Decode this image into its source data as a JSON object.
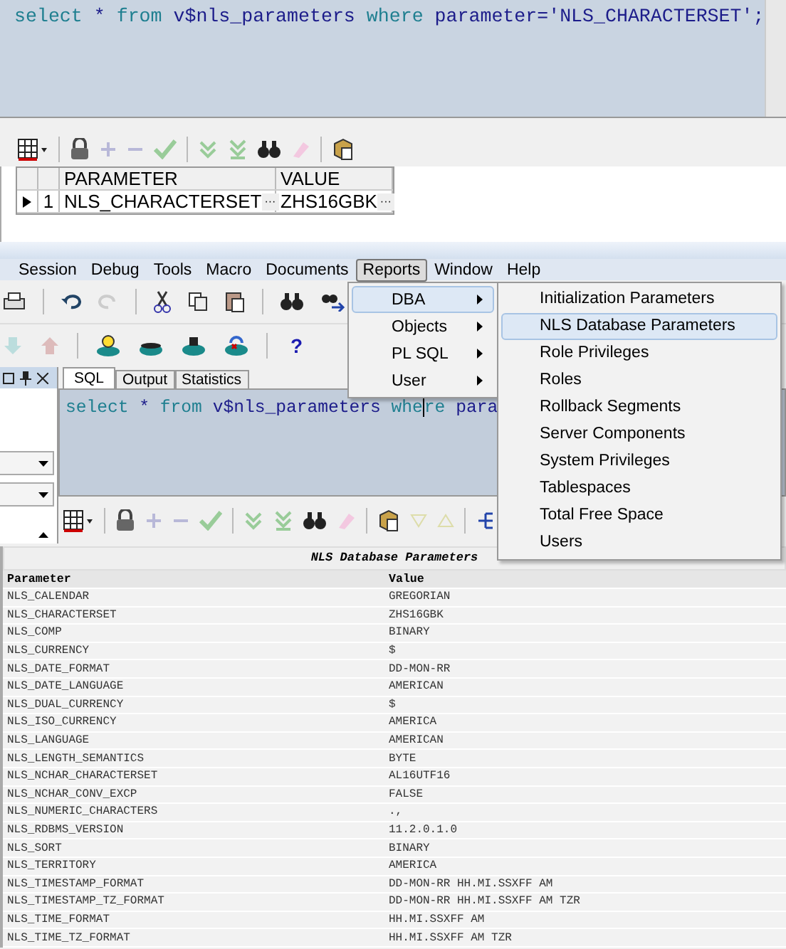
{
  "top_editor": {
    "tokens": [
      {
        "text": "select",
        "kind": "keyword"
      },
      {
        "text": " * ",
        "kind": "plain"
      },
      {
        "text": "from",
        "kind": "keyword"
      },
      {
        "text": " v$nls_parameters ",
        "kind": "plain"
      },
      {
        "text": "where",
        "kind": "keyword"
      },
      {
        "text": " parameter=",
        "kind": "plain"
      },
      {
        "text": "'NLS_CHARACTERSET'",
        "kind": "string"
      },
      {
        "text": ";",
        "kind": "plain"
      }
    ]
  },
  "result_grid": {
    "columns": [
      "PARAMETER",
      "VALUE"
    ],
    "rows": [
      {
        "number": "1",
        "selected": true,
        "cells": [
          {
            "text": "NLS_CHARACTERSET",
            "more": "···"
          },
          {
            "text": "ZHS16GBK",
            "more": "···"
          }
        ]
      }
    ]
  },
  "menu_bar": [
    {
      "label": "Session",
      "selected": false
    },
    {
      "label": "Debug",
      "selected": false
    },
    {
      "label": "Tools",
      "selected": false
    },
    {
      "label": "Macro",
      "selected": false
    },
    {
      "label": "Documents",
      "selected": false
    },
    {
      "label": "Reports",
      "selected": true
    },
    {
      "label": "Window",
      "selected": false
    },
    {
      "label": "Help",
      "selected": false
    }
  ],
  "reports_menu": [
    {
      "label": "DBA",
      "selected": true
    },
    {
      "label": "Objects",
      "selected": false
    },
    {
      "label": "PL SQL",
      "selected": false
    },
    {
      "label": "User",
      "selected": false
    }
  ],
  "dba_submenu": [
    {
      "label": "Initialization Parameters",
      "selected": false
    },
    {
      "label": "NLS Database Parameters",
      "selected": true
    },
    {
      "label": "Role Privileges",
      "selected": false
    },
    {
      "label": "Roles",
      "selected": false
    },
    {
      "label": "Rollback Segments",
      "selected": false
    },
    {
      "label": "Server Components",
      "selected": false
    },
    {
      "label": "System Privileges",
      "selected": false
    },
    {
      "label": "Tablespaces",
      "selected": false
    },
    {
      "label": "Total Free Space",
      "selected": false
    },
    {
      "label": "Users",
      "selected": false
    }
  ],
  "help_button": "?",
  "editor_tabs": [
    {
      "label": "SQL",
      "selected": true
    },
    {
      "label": "Output",
      "selected": false
    },
    {
      "label": "Statistics",
      "selected": false
    }
  ],
  "editor": {
    "tokens": [
      {
        "text": "select",
        "kind": "keyword",
        "caret": false
      },
      {
        "text": " * ",
        "kind": "plain",
        "caret": false
      },
      {
        "text": "from",
        "kind": "keyword",
        "caret": false
      },
      {
        "text": " v$nls_parameters ",
        "kind": "plain",
        "caret": false
      },
      {
        "text": "whe",
        "kind": "keyword",
        "caret": true
      },
      {
        "text": "re",
        "kind": "keyword",
        "caret": false
      },
      {
        "text": " para",
        "kind": "plain",
        "caret": false
      }
    ]
  },
  "report": {
    "title": "NLS Database Parameters",
    "columns": [
      "Parameter",
      "Value"
    ],
    "rows": [
      {
        "parameter": "NLS_CALENDAR",
        "value": "GREGORIAN"
      },
      {
        "parameter": "NLS_CHARACTERSET",
        "value": "ZHS16GBK"
      },
      {
        "parameter": "NLS_COMP",
        "value": "BINARY"
      },
      {
        "parameter": "NLS_CURRENCY",
        "value": "$"
      },
      {
        "parameter": "NLS_DATE_FORMAT",
        "value": "DD-MON-RR"
      },
      {
        "parameter": "NLS_DATE_LANGUAGE",
        "value": "AMERICAN"
      },
      {
        "parameter": "NLS_DUAL_CURRENCY",
        "value": "$"
      },
      {
        "parameter": "NLS_ISO_CURRENCY",
        "value": "AMERICA"
      },
      {
        "parameter": "NLS_LANGUAGE",
        "value": "AMERICAN"
      },
      {
        "parameter": "NLS_LENGTH_SEMANTICS",
        "value": "BYTE"
      },
      {
        "parameter": "NLS_NCHAR_CHARACTERSET",
        "value": "AL16UTF16"
      },
      {
        "parameter": "NLS_NCHAR_CONV_EXCP",
        "value": "FALSE"
      },
      {
        "parameter": "NLS_NUMERIC_CHARACTERS",
        "value": ".,"
      },
      {
        "parameter": "NLS_RDBMS_VERSION",
        "value": "11.2.0.1.0"
      },
      {
        "parameter": "NLS_SORT",
        "value": "BINARY"
      },
      {
        "parameter": "NLS_TERRITORY",
        "value": "AMERICA"
      },
      {
        "parameter": "NLS_TIMESTAMP_FORMAT",
        "value": "DD-MON-RR HH.MI.SSXFF AM"
      },
      {
        "parameter": "NLS_TIMESTAMP_TZ_FORMAT",
        "value": "DD-MON-RR HH.MI.SSXFF AM TZR"
      },
      {
        "parameter": "NLS_TIME_FORMAT",
        "value": "HH.MI.SSXFF AM"
      },
      {
        "parameter": "NLS_TIME_TZ_FORMAT",
        "value": "HH.MI.SSXFF AM TZR"
      }
    ]
  }
}
